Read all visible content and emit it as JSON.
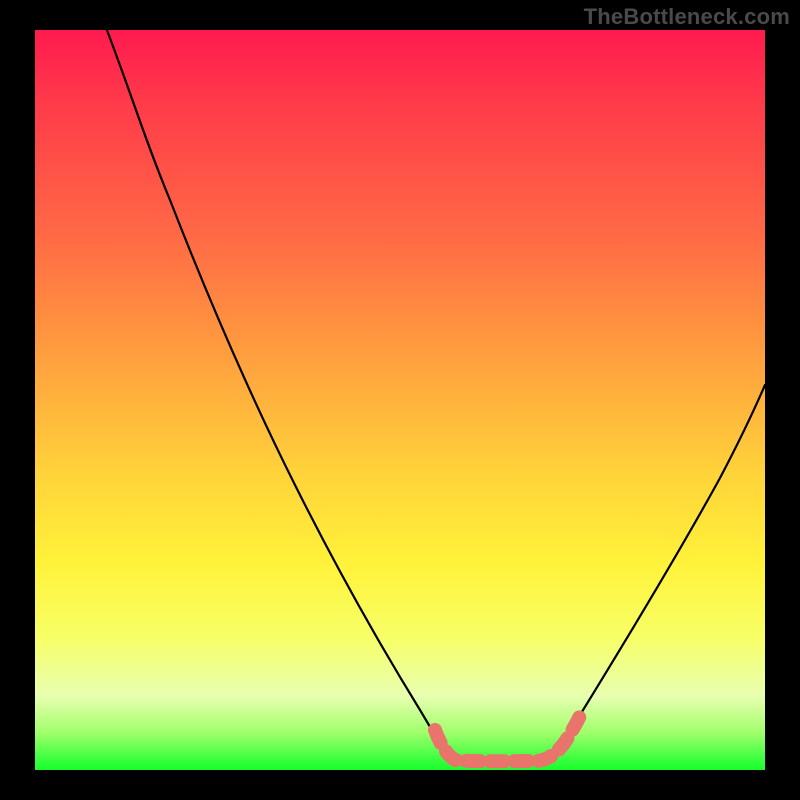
{
  "watermark": "TheBottleneck.com",
  "chart_data": {
    "type": "line",
    "title": "",
    "xlabel": "",
    "ylabel": "",
    "xlim": [
      0,
      100
    ],
    "ylim": [
      0,
      100
    ],
    "grid": false,
    "legend": false,
    "series": [
      {
        "name": "bottleneck-curve",
        "stroke": "#000000",
        "x": [
          10,
          15,
          20,
          25,
          30,
          35,
          40,
          45,
          50,
          55,
          57,
          60,
          63,
          66,
          69,
          70,
          73,
          78,
          82,
          86,
          90,
          94,
          97,
          100
        ],
        "values": [
          100,
          90,
          80,
          70,
          60,
          50,
          40,
          30,
          20,
          10,
          5,
          1,
          0,
          0,
          0,
          1,
          5,
          12,
          20,
          30,
          40,
          50,
          58,
          66
        ]
      },
      {
        "name": "optimal-band",
        "stroke": "#e8746b",
        "x": [
          55,
          57,
          60,
          63,
          66,
          69,
          70,
          73
        ],
        "values": [
          10,
          5,
          1,
          0,
          0,
          0,
          1,
          5
        ]
      }
    ],
    "gradient_stops": [
      {
        "pos": 0,
        "color": "#ff1a4f"
      },
      {
        "pos": 28,
        "color": "#ff6a45"
      },
      {
        "pos": 60,
        "color": "#ffd33a"
      },
      {
        "pos": 82,
        "color": "#f7ff66"
      },
      {
        "pos": 99,
        "color": "#2eff3a"
      },
      {
        "pos": 100,
        "color": "#1aff2a"
      }
    ]
  }
}
